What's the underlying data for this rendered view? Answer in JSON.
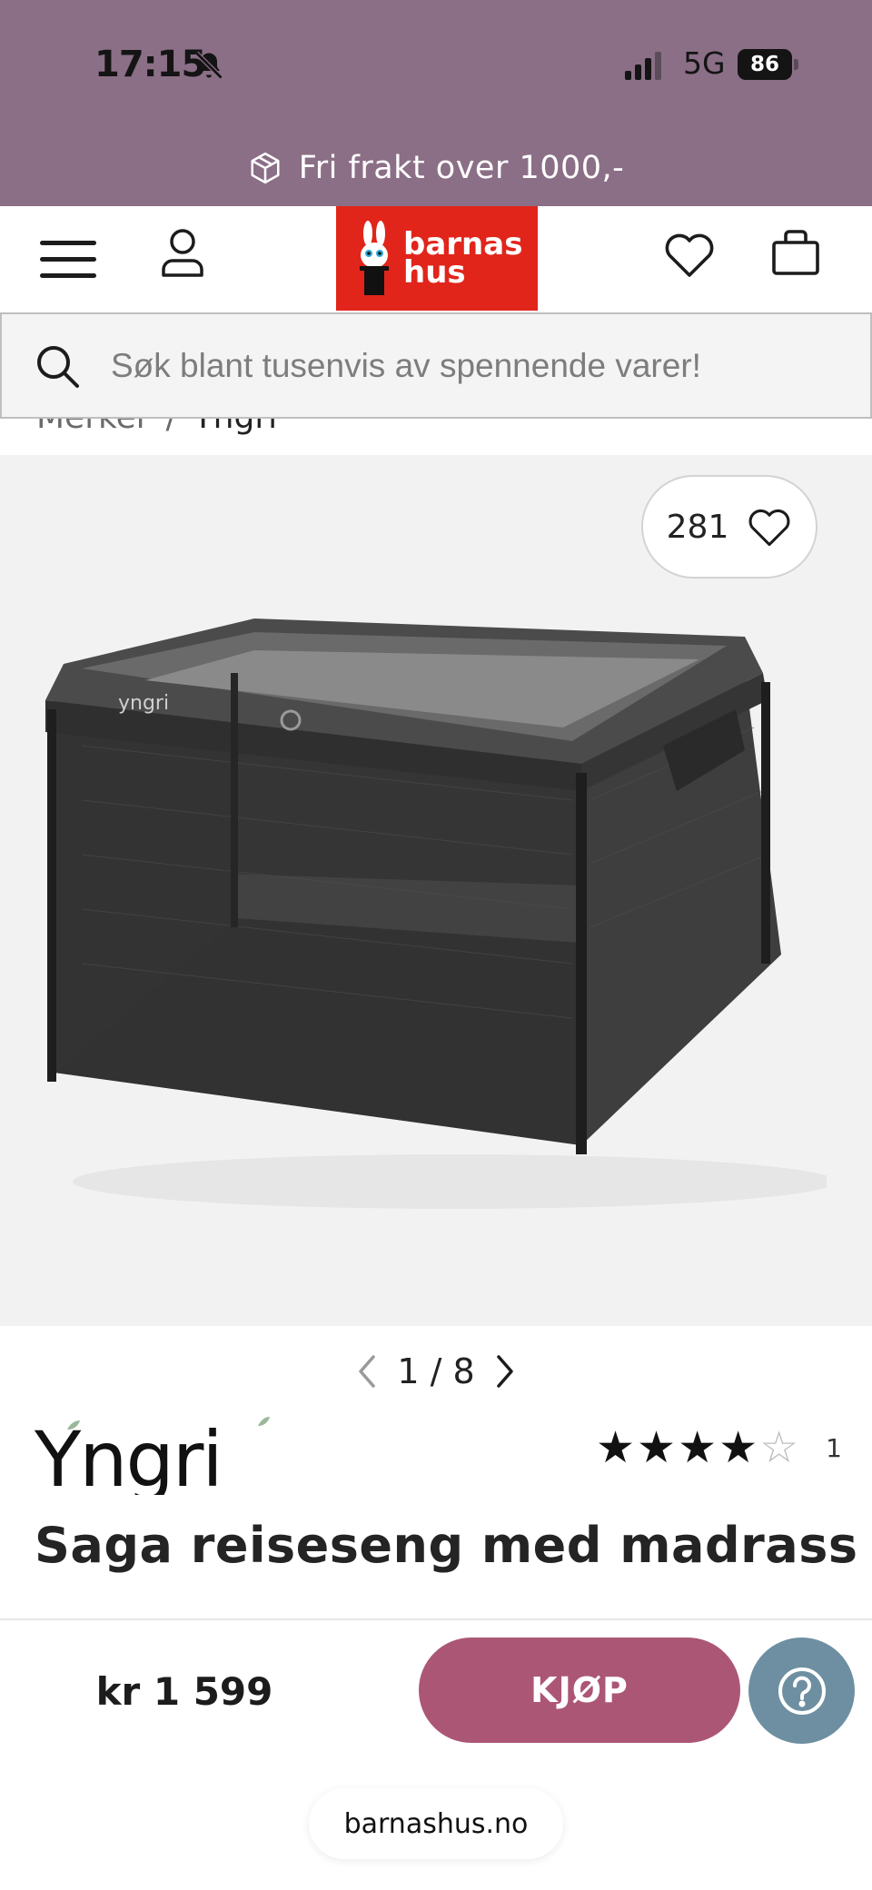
{
  "status_bar": {
    "time": "17:15",
    "network": "5G",
    "battery": "86",
    "icons": [
      "bell-off-icon",
      "signal-icon",
      "battery-icon"
    ]
  },
  "promo": {
    "text": "Fri frakt over 1000,-",
    "icon": "package-icon"
  },
  "header": {
    "logo_line1": "barnas",
    "logo_line2": "hus",
    "icons": [
      "menu-icon",
      "user-icon",
      "heart-icon",
      "shopping-bag-icon"
    ]
  },
  "search": {
    "placeholder": "Søk blant tusenvis av spennende varer!"
  },
  "breadcrumb": {
    "items": [
      "Merker",
      "Yngri"
    ],
    "separator": "/"
  },
  "gallery": {
    "favorite_count": "281",
    "current": "1",
    "total": "8",
    "pager_text": "1 / 8"
  },
  "product": {
    "brand": "Yngri",
    "title": "Saga reiseseng med madrass",
    "rating_stars": "★★★★",
    "rating_empty": "☆",
    "rating_value": 4,
    "rating_max": 5,
    "rating_count": "1",
    "price": "kr 1 599"
  },
  "actions": {
    "buy_label": "KJØP",
    "help_icon": "help-icon"
  },
  "browser": {
    "url": "barnashus.no"
  },
  "colors": {
    "top_band": "#8b6f86",
    "logo_red": "#e1251b",
    "buy_button": "#ac5676",
    "help_button": "#6e8fa1"
  }
}
